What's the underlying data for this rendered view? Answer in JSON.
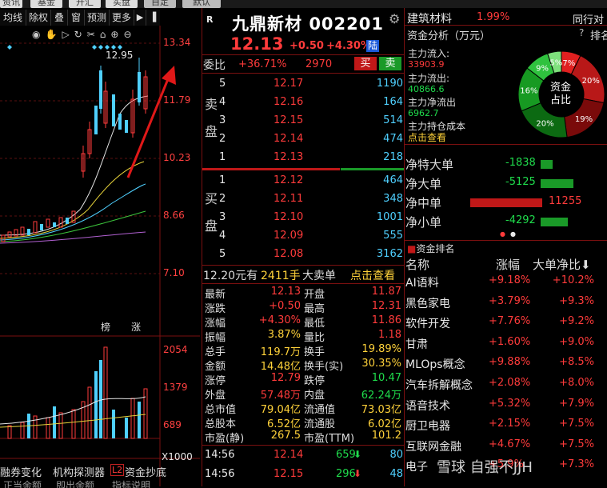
{
  "top_menu": [
    "资讯",
    "基金",
    "开汇",
    "实盘",
    "自定",
    "默认"
  ],
  "chart_toolbar": {
    "items": [
      "均线",
      "除权",
      "叠",
      "窗",
      "预测",
      "更多"
    ],
    "price_peak_label": "12.95",
    "axis_prices": [
      "13.34",
      "11.79",
      "10.23",
      "8.66",
      "7.10"
    ],
    "markers": [
      "榜",
      "涨"
    ],
    "vol_axis": [
      "2054",
      "1379",
      "689"
    ],
    "vol_unit": "X1000"
  },
  "bottom_tabs": {
    "items": [
      "融券变化",
      "机构探测器",
      "资金抄底"
    ],
    "tab3_badge": "L2",
    "row2": [
      "正当余额",
      "即出余额",
      "指标说明"
    ]
  },
  "header": {
    "r_badge": "R",
    "stock_name": "九鼎新材",
    "stock_code": "002201",
    "price": "12.13",
    "change": "+0.50",
    "change_pct": "+4.30%",
    "exchange": "陆"
  },
  "committee": {
    "label": "委比",
    "ratio": "+36.71%",
    "diff": "2970",
    "buy_btn": "买",
    "sell_btn": "卖"
  },
  "order_book": {
    "sell_label": [
      "卖",
      "盘"
    ],
    "buy_label": [
      "买",
      "盘"
    ],
    "sell": [
      {
        "level": "5",
        "price": "12.17",
        "volume": "1190"
      },
      {
        "level": "4",
        "price": "12.16",
        "volume": "164"
      },
      {
        "level": "3",
        "price": "12.15",
        "volume": "514"
      },
      {
        "level": "2",
        "price": "12.14",
        "volume": "474"
      },
      {
        "level": "1",
        "price": "12.13",
        "volume": "218"
      }
    ],
    "buy": [
      {
        "level": "1",
        "price": "12.12",
        "volume": "464"
      },
      {
        "level": "2",
        "price": "12.11",
        "volume": "348"
      },
      {
        "level": "3",
        "price": "12.10",
        "volume": "1001"
      },
      {
        "level": "4",
        "price": "12.09",
        "volume": "555"
      },
      {
        "level": "5",
        "price": "12.08",
        "volume": "3162"
      }
    ]
  },
  "big_order": {
    "price": "12.20元有",
    "qty": "2411手",
    "label": "大卖单",
    "link": "点击查看"
  },
  "quote": [
    {
      "l1": "最新",
      "v1": "12.13",
      "l2": "开盘",
      "v2": "11.87"
    },
    {
      "l1": "涨跌",
      "v1": "+0.50",
      "l2": "最高",
      "v2": "12.31"
    },
    {
      "l1": "涨幅",
      "v1": "+4.30%",
      "l2": "最低",
      "v2": "11.86"
    },
    {
      "l1": "振幅",
      "v1": "3.87%",
      "l2": "量比",
      "v2": "1.18"
    },
    {
      "l1": "总手",
      "v1": "119.7万",
      "l2": "换手",
      "v2": "19.89%"
    },
    {
      "l1": "金额",
      "v1": "14.48亿",
      "l2": "换手(实)",
      "v2": "30.35%"
    },
    {
      "l1": "涨停",
      "v1": "12.79",
      "l2": "跌停",
      "v2": "10.47"
    },
    {
      "l1": "外盘",
      "v1": "57.48万",
      "l2": "内盘",
      "v2": "62.24万"
    },
    {
      "l1": "总市值",
      "v1": "79.04亿",
      "l2": "流通值",
      "v2": "73.03亿"
    },
    {
      "l1": "总股本",
      "v1": "6.52亿",
      "l2": "流通股",
      "v2": "6.02亿"
    },
    {
      "l1": "市盈(静)",
      "v1": "267.5",
      "l2": "市盈(TTM)",
      "v2": "101.2"
    }
  ],
  "ticks": [
    {
      "time": "14:56",
      "price": "12.14",
      "vol": "659",
      "num": "80"
    },
    {
      "time": "14:56",
      "price": "12.15",
      "vol": "296",
      "num": "48"
    }
  ],
  "sector": {
    "name": "建筑材料",
    "pct": "1.99%",
    "right_label": "同行对"
  },
  "fund": {
    "title": "资金分析（万元）",
    "help": "?",
    "rank_link": "排名",
    "inflow_label": "主力流入:",
    "inflow": "33903.9",
    "outflow_label": "主力流出:",
    "outflow": "40866.6",
    "net_label": "主力净流出",
    "net": "6962.7",
    "cost_label": "主力持仓成本",
    "cost_link": "点击查看",
    "donut_center": [
      "资金",
      "占比"
    ],
    "donut": [
      {
        "label": "7%",
        "value": 7,
        "color": "#e02020"
      },
      {
        "label": "20%",
        "value": 20,
        "color": "#b81818"
      },
      {
        "label": "19%",
        "value": 19,
        "color": "#7a0a0a"
      },
      {
        "label": "20%",
        "value": 20,
        "color": "#0c6a12"
      },
      {
        "label": "16%",
        "value": 16,
        "color": "#179a22"
      },
      {
        "label": "9%",
        "value": 9,
        "color": "#2fc23e"
      },
      {
        "label": "5%",
        "value": 5,
        "color": "#7ee07c"
      }
    ]
  },
  "flows": [
    {
      "label": "净特大单",
      "value": "-1838",
      "dir": "out",
      "mag": 1838
    },
    {
      "label": "净大单",
      "value": "-5125",
      "dir": "out",
      "mag": 5125
    },
    {
      "label": "净中单",
      "value": "11255",
      "dir": "in",
      "mag": 11255
    },
    {
      "label": "净小单",
      "value": "-4292",
      "dir": "out",
      "mag": 4292
    }
  ],
  "rank": {
    "title": "资金排名",
    "col_name": "名称",
    "col_pct": "涨幅",
    "col_net": "大单净比",
    "rows": [
      {
        "name": "AI语料",
        "pct": "+9.18%",
        "net": "+10.2%"
      },
      {
        "name": "黑色家电",
        "pct": "+3.79%",
        "net": "+9.3%"
      },
      {
        "name": "软件开发",
        "pct": "+7.76%",
        "net": "+9.2%"
      },
      {
        "name": "甘肃",
        "pct": "+1.60%",
        "net": "+9.0%"
      },
      {
        "name": "MLOps概念",
        "pct": "+9.88%",
        "net": "+8.5%"
      },
      {
        "name": "汽车拆解概念",
        "pct": "+2.08%",
        "net": "+8.0%"
      },
      {
        "name": "语音技术",
        "pct": "+5.32%",
        "net": "+7.9%"
      },
      {
        "name": "厨卫电器",
        "pct": "+2.15%",
        "net": "+7.5%"
      },
      {
        "name": "互联网金融",
        "pct": "+4.67%",
        "net": "+7.5%"
      },
      {
        "name": "电子",
        "pct": "+5.9%",
        "net": "+7.3%"
      }
    ]
  },
  "watermark": "雪球  自强不JJH"
}
